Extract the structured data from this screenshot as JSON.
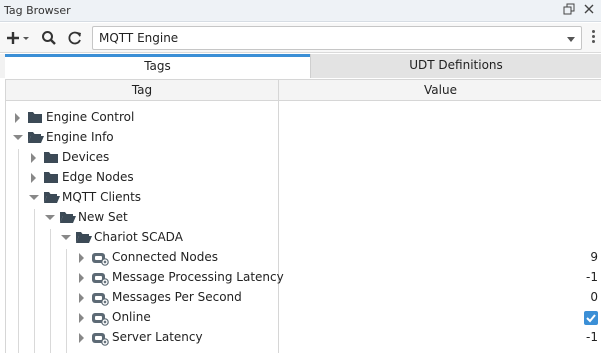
{
  "window": {
    "title": "Tag Browser",
    "buttons": [
      "restore-icon",
      "close-icon"
    ]
  },
  "toolbar": {
    "add_icon": "plus-icon",
    "search_icon": "search-icon",
    "refresh_icon": "refresh-icon",
    "provider_value": "MQTT Engine",
    "menu_icon": "kebab-icon"
  },
  "tabs": [
    {
      "label": "Tags",
      "active": true
    },
    {
      "label": "UDT Definitions",
      "active": false
    }
  ],
  "table": {
    "headers": [
      "Tag",
      "Value"
    ],
    "rows": [
      {
        "label": "Engine Control",
        "depth": 0,
        "state": "collapsed",
        "kind": "folder",
        "value": ""
      },
      {
        "label": "Engine Info",
        "depth": 0,
        "state": "expanded",
        "kind": "folder-open",
        "value": ""
      },
      {
        "label": "Devices",
        "depth": 1,
        "state": "collapsed",
        "kind": "folder",
        "value": ""
      },
      {
        "label": "Edge Nodes",
        "depth": 1,
        "state": "collapsed",
        "kind": "folder",
        "value": ""
      },
      {
        "label": "MQTT Clients",
        "depth": 1,
        "state": "expanded",
        "kind": "folder-open",
        "value": ""
      },
      {
        "label": "New Set",
        "depth": 2,
        "state": "expanded",
        "kind": "folder-open",
        "value": ""
      },
      {
        "label": "Chariot SCADA",
        "depth": 3,
        "state": "expanded",
        "kind": "folder-open",
        "value": ""
      },
      {
        "label": "Connected Nodes",
        "depth": 4,
        "state": "collapsed",
        "kind": "tag",
        "value": "9"
      },
      {
        "label": "Message Processing Latency",
        "depth": 4,
        "state": "collapsed",
        "kind": "tag",
        "value": "-1"
      },
      {
        "label": "Messages Per Second",
        "depth": 4,
        "state": "collapsed",
        "kind": "tag",
        "value": "0"
      },
      {
        "label": "Online",
        "depth": 4,
        "state": "collapsed",
        "kind": "tag",
        "value": "",
        "checked": true
      },
      {
        "label": "Server Latency",
        "depth": 4,
        "state": "collapsed",
        "kind": "tag",
        "value": "-1"
      }
    ]
  },
  "colors": {
    "accent": "#3b8fd6",
    "folder": "#3c4a56"
  }
}
